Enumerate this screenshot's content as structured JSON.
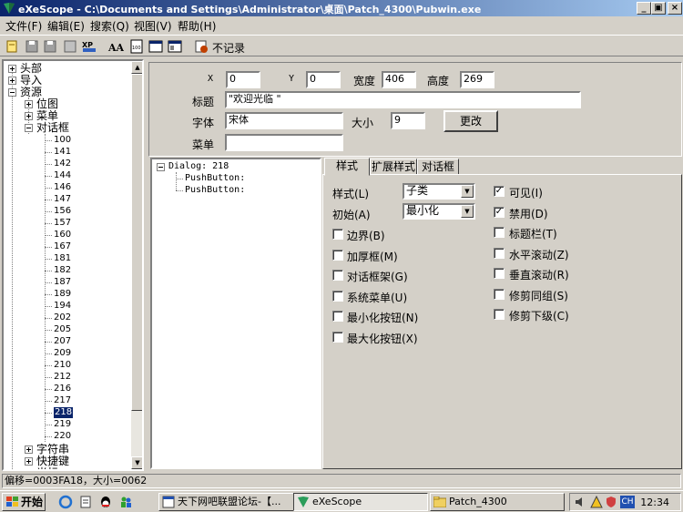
{
  "window": {
    "title": "eXeScope - C:\\Documents and Settings\\Administrator\\桌面\\Patch_4300\\Pubwin.exe",
    "min": "_",
    "max": "▣",
    "close": "×"
  },
  "menu": [
    "文件(F)",
    "编辑(E)",
    "搜索(Q)",
    "视图(V)",
    "帮助(H)"
  ],
  "toolbar": {
    "no_record": "不记录"
  },
  "tree": {
    "top": [
      {
        "label": "头部"
      },
      {
        "label": "导入"
      },
      {
        "label": "资源"
      }
    ],
    "resources": [
      {
        "label": "位图"
      },
      {
        "label": "菜单"
      },
      {
        "label": "对话框"
      }
    ],
    "dialog_ids": [
      "100",
      "141",
      "142",
      "144",
      "146",
      "147",
      "156",
      "157",
      "160",
      "167",
      "181",
      "182",
      "187",
      "189",
      "194",
      "202",
      "205",
      "207",
      "209",
      "210",
      "212",
      "216",
      "217",
      "218",
      "219",
      "220"
    ],
    "selected": "218",
    "tail": [
      {
        "label": "字符串"
      },
      {
        "label": "快捷键"
      },
      {
        "label": "光标"
      }
    ]
  },
  "props": {
    "x_label": "X",
    "x_value": "0",
    "y_label": "Y",
    "y_value": "0",
    "width_label": "宽度",
    "width_value": "406",
    "height_label": "高度",
    "height_value": "269",
    "title_label": "标题",
    "title_value": "\"欢迎光临 \"",
    "font_label": "字体",
    "font_value": "宋体",
    "size_label": "大小",
    "size_value": "9",
    "change_button": "更改",
    "menu_label": "菜单",
    "menu_value": ""
  },
  "dialog_tree": {
    "root": "Dialog: 218",
    "children": [
      "PushButton:",
      "PushButton:"
    ]
  },
  "tabs": [
    "样式",
    "扩展样式",
    "对话框"
  ],
  "style": {
    "style_label": "样式(L)",
    "style_value": "子类",
    "init_label": "初始(A)",
    "init_value": "最小化",
    "left": [
      {
        "label": "边界(B)",
        "checked": false
      },
      {
        "label": "加厚框(M)",
        "checked": false
      },
      {
        "label": "对话框架(G)",
        "checked": false
      },
      {
        "label": "系统菜单(U)",
        "checked": false
      },
      {
        "label": "最小化按钮(N)",
        "checked": false
      },
      {
        "label": "最大化按钮(X)",
        "checked": false
      }
    ],
    "right": [
      {
        "label": "可见(I)",
        "checked": true
      },
      {
        "label": "禁用(D)",
        "checked": true
      },
      {
        "label": "标题栏(T)",
        "checked": false
      },
      {
        "label": "水平滚动(Z)",
        "checked": false
      },
      {
        "label": "垂直滚动(R)",
        "checked": false
      },
      {
        "label": "修剪同组(S)",
        "checked": false
      },
      {
        "label": "修剪下级(C)",
        "checked": false
      }
    ]
  },
  "status": "偏移=0003FA18，大小=0062",
  "taskbar": {
    "start": "开始",
    "tasks": [
      "天下网吧联盟论坛-【...",
      "eXeScope",
      "Patch_4300"
    ],
    "ime": "CH",
    "clock": "12:34"
  },
  "colors": {
    "title_start": "#0a246a",
    "title_end": "#a6caf0",
    "face": "#d4d0c8",
    "selection": "#0a246a"
  }
}
